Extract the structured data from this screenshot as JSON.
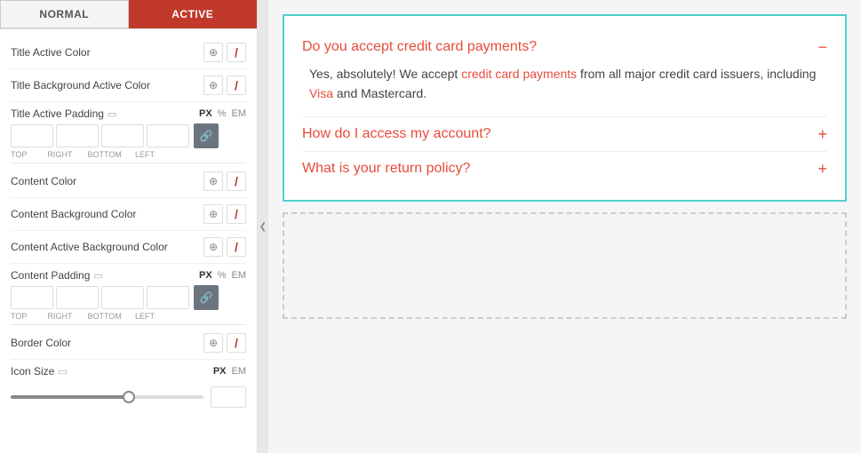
{
  "tabs": [
    {
      "id": "normal",
      "label": "NORMAL"
    },
    {
      "id": "active",
      "label": "ACTIVE",
      "isActive": true
    }
  ],
  "settings": {
    "title_active_color": {
      "label": "Title Active Color"
    },
    "title_bg_active_color": {
      "label": "Title Background Active Color"
    },
    "title_active_padding": {
      "label": "Title Active Padding",
      "units": [
        "PX",
        "%",
        "EM"
      ]
    },
    "content_color": {
      "label": "Content Color"
    },
    "content_bg_color": {
      "label": "Content Background Color"
    },
    "content_active_bg_color": {
      "label": "Content Active Background Color"
    },
    "content_padding": {
      "label": "Content Padding",
      "units": [
        "PX",
        "%",
        "EM"
      ]
    },
    "border_color": {
      "label": "Border Color"
    },
    "icon_size": {
      "label": "Icon Size",
      "units": [
        "PX",
        "EM"
      ]
    }
  },
  "padding_sublabels": [
    "TOP",
    "RIGHT",
    "BOTTOM",
    "LEFT"
  ],
  "faq": {
    "items": [
      {
        "id": 1,
        "question": "Do you accept credit card payments?",
        "answer": "Yes, absolutely! We accept credit card payments from all major credit card issuers, including Visa and Mastercard.",
        "expanded": true,
        "toggle": "−"
      },
      {
        "id": 2,
        "question": "How do I access my account?",
        "answer": "",
        "expanded": false,
        "toggle": "+"
      },
      {
        "id": 3,
        "question": "What is your return policy?",
        "answer": "",
        "expanded": false,
        "toggle": "+"
      }
    ]
  },
  "icons": {
    "globe": "⊕",
    "slash": "/",
    "link": "🔗",
    "monitor": "▭",
    "collapse": "❮"
  }
}
